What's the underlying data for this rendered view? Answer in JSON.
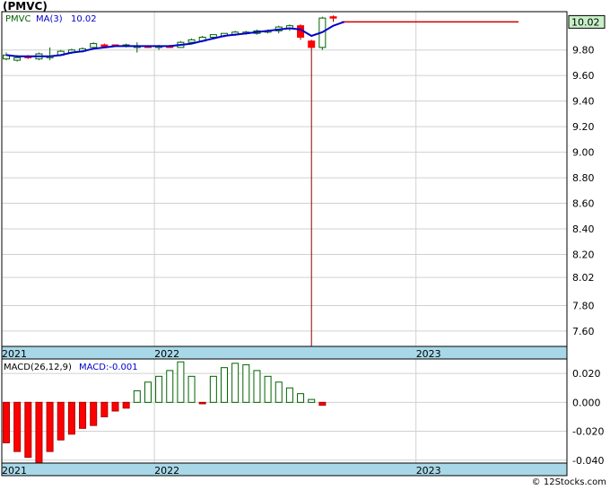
{
  "title": "(PMVC)",
  "footer": "© 12Stocks.com",
  "colors": {
    "up": "#006400",
    "down": "#ff0000",
    "ma": "#0000cc",
    "price_label_bg": "#c8f0c8",
    "axis_band": "#a8d8e8"
  },
  "chart_data": [
    {
      "type": "candlestick",
      "ticker_label": "PMVC",
      "ma_label": "MA(3)",
      "ma_value": "10.02",
      "last_price_label": "10.02",
      "x_tick_labels": [
        "2021",
        "2022",
        "2023"
      ],
      "x_tick_positions": [
        0,
        14,
        38
      ],
      "y_ticks": [
        "9.80",
        "9.60",
        "9.40",
        "9.20",
        "9.00",
        "8.80",
        "8.60",
        "8.40",
        "8.20",
        "8.02",
        "7.80",
        "7.60"
      ],
      "ylim": [
        7.48,
        10.1
      ],
      "grid": true,
      "candles": [
        {
          "o": 9.73,
          "h": 9.78,
          "l": 9.72,
          "c": 9.76
        },
        {
          "o": 9.72,
          "h": 9.76,
          "l": 9.71,
          "c": 9.74
        },
        {
          "o": 9.75,
          "h": 9.76,
          "l": 9.73,
          "c": 9.74
        },
        {
          "o": 9.73,
          "h": 9.78,
          "l": 9.72,
          "c": 9.77
        },
        {
          "o": 9.74,
          "h": 9.82,
          "l": 9.72,
          "c": 9.75
        },
        {
          "o": 9.76,
          "h": 9.8,
          "l": 9.75,
          "c": 9.79
        },
        {
          "o": 9.78,
          "h": 9.81,
          "l": 9.77,
          "c": 9.8
        },
        {
          "o": 9.79,
          "h": 9.82,
          "l": 9.78,
          "c": 9.81
        },
        {
          "o": 9.82,
          "h": 9.86,
          "l": 9.81,
          "c": 9.85
        },
        {
          "o": 9.84,
          "h": 9.85,
          "l": 9.82,
          "c": 9.83
        },
        {
          "o": 9.84,
          "h": 9.84,
          "l": 9.83,
          "c": 9.83
        },
        {
          "o": 9.83,
          "h": 9.85,
          "l": 9.82,
          "c": 9.84
        },
        {
          "o": 9.82,
          "h": 9.86,
          "l": 9.78,
          "c": 9.83
        },
        {
          "o": 9.83,
          "h": 9.83,
          "l": 9.82,
          "c": 9.82
        },
        {
          "o": 9.82,
          "h": 9.84,
          "l": 9.8,
          "c": 9.83
        },
        {
          "o": 9.83,
          "h": 9.84,
          "l": 9.82,
          "c": 9.82
        },
        {
          "o": 9.82,
          "h": 9.87,
          "l": 9.82,
          "c": 9.86
        },
        {
          "o": 9.86,
          "h": 9.89,
          "l": 9.85,
          "c": 9.88
        },
        {
          "o": 9.87,
          "h": 9.91,
          "l": 9.86,
          "c": 9.9
        },
        {
          "o": 9.9,
          "h": 9.92,
          "l": 9.89,
          "c": 9.92
        },
        {
          "o": 9.91,
          "h": 9.93,
          "l": 9.9,
          "c": 9.93
        },
        {
          "o": 9.92,
          "h": 9.95,
          "l": 9.91,
          "c": 9.94
        },
        {
          "o": 9.93,
          "h": 9.95,
          "l": 9.92,
          "c": 9.94
        },
        {
          "o": 9.93,
          "h": 9.96,
          "l": 9.92,
          "c": 9.95
        },
        {
          "o": 9.94,
          "h": 9.96,
          "l": 9.93,
          "c": 9.95
        },
        {
          "o": 9.95,
          "h": 9.99,
          "l": 9.93,
          "c": 9.98
        },
        {
          "o": 9.97,
          "h": 10.0,
          "l": 9.95,
          "c": 9.99
        },
        {
          "o": 9.99,
          "h": 10.0,
          "l": 9.88,
          "c": 9.9
        },
        {
          "o": 9.87,
          "h": 9.88,
          "l": 7.48,
          "c": 9.82
        },
        {
          "o": 9.82,
          "h": 10.06,
          "l": 9.8,
          "c": 10.05
        },
        {
          "o": 10.06,
          "h": 10.07,
          "l": 10.02,
          "c": 10.05
        }
      ],
      "flat_line": {
        "from_index": 31,
        "to_index": 47,
        "value": 10.02
      },
      "ma": [
        9.76,
        9.75,
        9.75,
        9.75,
        9.75,
        9.76,
        9.78,
        9.79,
        9.81,
        9.82,
        9.83,
        9.83,
        9.83,
        9.83,
        9.83,
        9.83,
        9.84,
        9.85,
        9.87,
        9.89,
        9.91,
        9.92,
        9.93,
        9.94,
        9.95,
        9.96,
        9.97,
        9.96,
        9.91,
        9.94,
        9.99,
        10.02
      ]
    },
    {
      "type": "bar",
      "label": "MACD(26,12,9)",
      "value_label": "MACD:-0.001",
      "x_tick_labels": [
        "2021",
        "2022",
        "2023"
      ],
      "x_tick_positions": [
        0,
        14,
        38
      ],
      "y_ticks": [
        "0.020",
        "0.000",
        "-0.020",
        "-0.040"
      ],
      "ylim": [
        -0.042,
        0.03
      ],
      "grid": true,
      "values": [
        -0.028,
        -0.034,
        -0.038,
        -0.042,
        -0.034,
        -0.026,
        -0.022,
        -0.018,
        -0.016,
        -0.01,
        -0.006,
        -0.004,
        0.008,
        0.014,
        0.018,
        0.022,
        0.028,
        0.018,
        -0.001,
        0.018,
        0.024,
        0.027,
        0.026,
        0.022,
        0.018,
        0.014,
        0.01,
        0.006,
        0.002,
        -0.002
      ]
    }
  ]
}
